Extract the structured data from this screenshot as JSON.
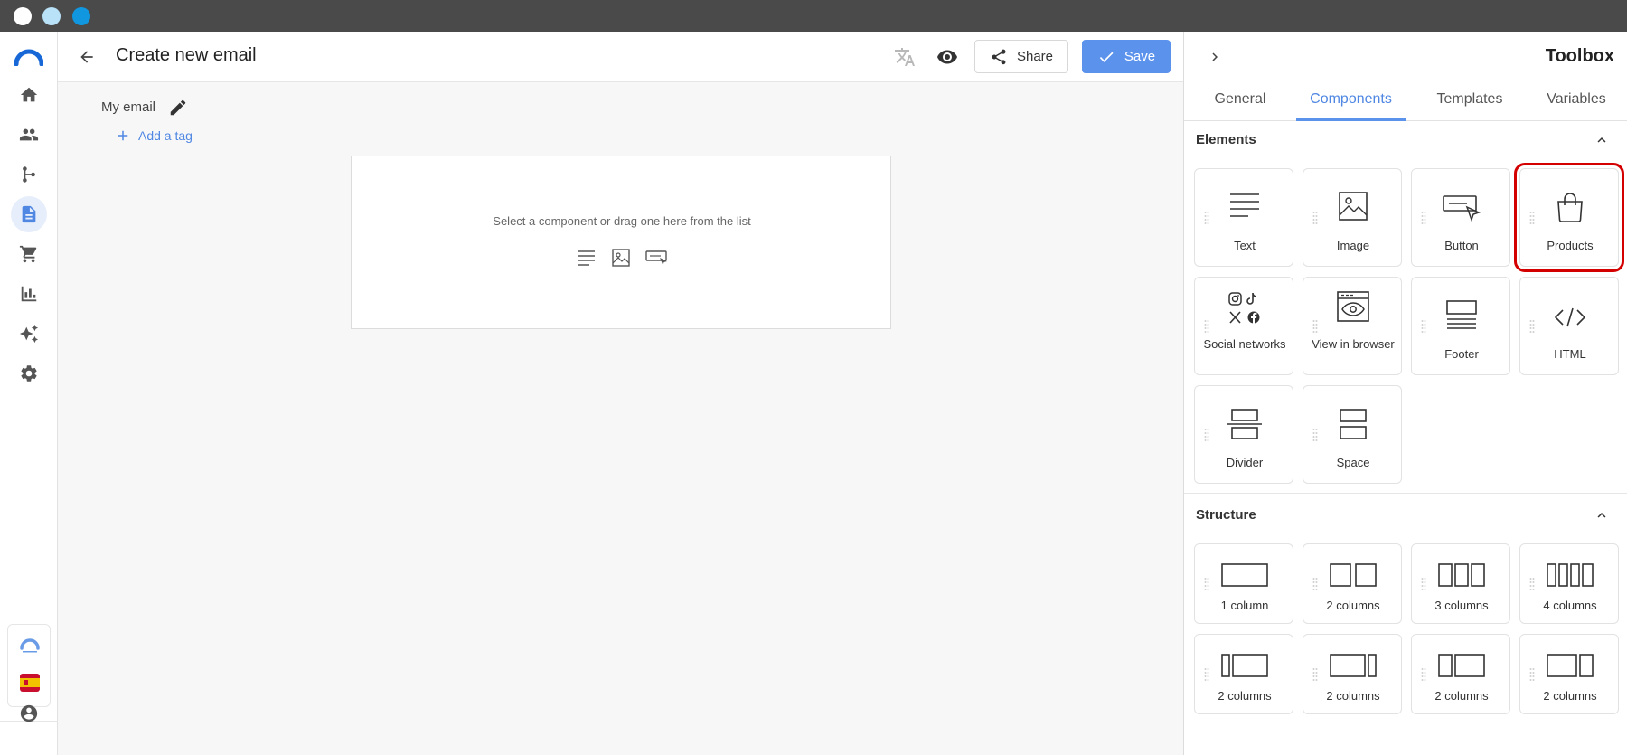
{
  "window": {
    "dots": [
      "close",
      "minimize",
      "maximize"
    ]
  },
  "sidebar": {
    "items": [
      {
        "name": "home",
        "icon": "home-icon"
      },
      {
        "name": "contacts",
        "icon": "people-icon"
      },
      {
        "name": "automations",
        "icon": "branch-icon"
      },
      {
        "name": "templates",
        "icon": "document-icon",
        "active": true
      },
      {
        "name": "shop",
        "icon": "cart-icon"
      },
      {
        "name": "reports",
        "icon": "bar-chart-icon"
      },
      {
        "name": "ai",
        "icon": "sparkles-icon"
      },
      {
        "name": "settings",
        "icon": "gear-icon"
      }
    ],
    "account": {
      "icon": "user-circle-icon"
    }
  },
  "header": {
    "title": "Create new email",
    "share_label": "Share",
    "save_label": "Save"
  },
  "editor": {
    "email_name": "My email",
    "add_tag_label": "Add a tag",
    "canvas_hint": "Select a component or drag one here from the list"
  },
  "toolbox": {
    "title": "Toolbox",
    "tabs": [
      {
        "label": "General"
      },
      {
        "label": "Components",
        "active": true
      },
      {
        "label": "Templates"
      },
      {
        "label": "Variables"
      }
    ],
    "elements_title": "Elements",
    "elements": [
      {
        "label": "Text",
        "icon": "text-lines-icon"
      },
      {
        "label": "Image",
        "icon": "image-icon"
      },
      {
        "label": "Button",
        "icon": "button-cursor-icon"
      },
      {
        "label": "Products",
        "icon": "shopping-bag-icon",
        "highlighted": true
      },
      {
        "label": "Social networks",
        "icon": "social-icons"
      },
      {
        "label": "View in browser",
        "icon": "browser-eye-icon"
      },
      {
        "label": "Footer",
        "icon": "footer-icon"
      },
      {
        "label": "HTML",
        "icon": "code-icon"
      },
      {
        "label": "Divider",
        "icon": "divider-icon"
      },
      {
        "label": "Space",
        "icon": "space-icon"
      }
    ],
    "structure_title": "Structure",
    "structure": [
      {
        "label": "1 column",
        "icon": "layout-1-col-icon"
      },
      {
        "label": "2 columns",
        "icon": "layout-2-col-icon"
      },
      {
        "label": "3 columns",
        "icon": "layout-3-col-icon"
      },
      {
        "label": "4 columns",
        "icon": "layout-4-col-icon"
      },
      {
        "label": "2 columns",
        "icon": "layout-narrow-wide-icon"
      },
      {
        "label": "2 columns",
        "icon": "layout-wide-narrow-icon"
      },
      {
        "label": "2 columns",
        "icon": "layout-third-twothirds-icon"
      },
      {
        "label": "2 columns",
        "icon": "layout-twothirds-third-icon"
      }
    ]
  },
  "colors": {
    "accent": "#5b92ec",
    "highlight": "#d40000",
    "titlebar": "#4a4a4a"
  }
}
